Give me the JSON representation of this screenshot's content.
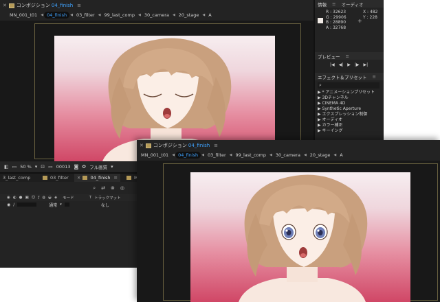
{
  "back_window": {
    "comp_panel": {
      "title_prefix": "コンポジション",
      "title_comp": "04_finish",
      "breadcrumbs": [
        "MN_001_t01",
        "04_finish",
        "03_filter",
        "99_last_comp",
        "30_camera",
        "20_stage",
        "A"
      ],
      "active_crumb": "04_finish"
    },
    "info_panel": {
      "tab_info": "情報",
      "tab_audio": "オーディオ",
      "r": "R : 32623",
      "g": "G : 29906",
      "b": "B : 28890",
      "a": "A : 32768",
      "x": "X : 482",
      "y": "Y : 228"
    },
    "preview_panel": {
      "title": "プレビュー"
    },
    "effects_panel": {
      "title": "エフェクト＆プリセット",
      "search_placeholder": "",
      "items": [
        "▶ * アニメーションプリセット",
        "▶ 3Dチャンネル",
        "▶ CINEMA 4D",
        "▶ Synthetic Aperture",
        "▶ エクスプレッション制御",
        "▶ オーディオ",
        "▶ カラー補正",
        "▶ キーイング"
      ]
    },
    "viewer_bar": {
      "zoom": "50 %",
      "timecode": "00013",
      "quality": "フル画質"
    },
    "timeline": {
      "tabs": [
        "3_last_comp",
        "03_filter",
        "04_finish",
        "M"
      ],
      "active_tab": "04_finish",
      "col_mode": "モード",
      "col_t": "T",
      "col_trackmatte": "トラックマット",
      "row_mode": "通常",
      "row_parent": "なし"
    }
  },
  "front_window": {
    "comp_panel": {
      "title_prefix": "コンポジション",
      "title_comp": "04_finish",
      "breadcrumbs": [
        "MN_001_t01",
        "04_finish",
        "03_filter",
        "99_last_comp",
        "30_camera",
        "20_stage",
        "A"
      ],
      "active_crumb": "04_finish"
    }
  },
  "colors": {
    "accent_blue": "#3fa3ff",
    "panel_bg": "#232323",
    "viewer_bg": "#181818",
    "label_tan": "#b59a57"
  },
  "icons": [
    "close-icon",
    "panel-menu-icon",
    "search-icon",
    "play-icon",
    "first-frame-icon",
    "last-frame-icon",
    "prev-frame-icon",
    "next-frame-icon",
    "loop-icon",
    "crosshair-icon",
    "monitor-icon",
    "camera-icon",
    "color-icon",
    "eye-icon",
    "lock-icon",
    "solo-icon",
    "label-chip-icon"
  ]
}
